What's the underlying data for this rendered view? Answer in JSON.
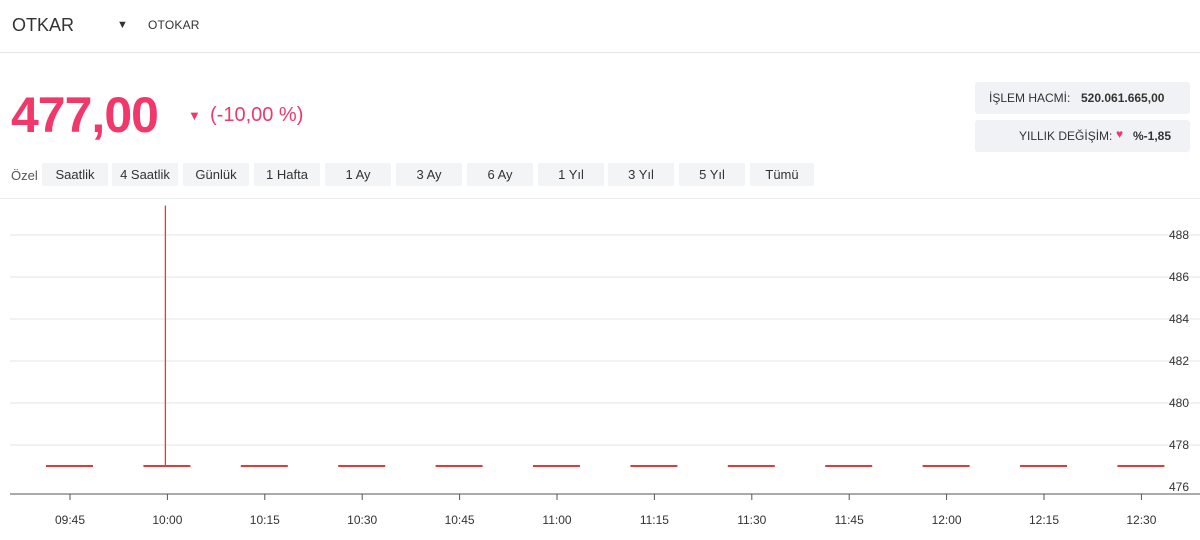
{
  "header": {
    "symbol": "OTKAR",
    "company": "OTOKAR"
  },
  "quote": {
    "price": "477,00",
    "change": "(-10,00 %)"
  },
  "stats": {
    "volume_label": "İŞLEM HACMİ:",
    "volume_value": "520.061.665,00",
    "yearly_label": "YILLIK DEĞİŞİM:",
    "yearly_value": "%-1,85"
  },
  "ranges": {
    "label": "Özel",
    "buttons": [
      "Saatlik",
      "4 Saatlik",
      "Günlük",
      "1 Hafta",
      "1 Ay",
      "3 Ay",
      "6 Ay",
      "1 Yıl",
      "3 Yıl",
      "5 Yıl",
      "Tümü"
    ],
    "active": "4 Saatlik"
  },
  "colors": {
    "accent": "#f0386b",
    "candle": "#e53935",
    "grid": "#e6e6e6"
  },
  "chart_data": {
    "type": "candlestick",
    "x": [
      "09:45",
      "10:00",
      "10:15",
      "10:30",
      "10:45",
      "11:00",
      "11:15",
      "11:30",
      "11:45",
      "12:00",
      "12:15",
      "12:30"
    ],
    "candles": [
      {
        "open": 477,
        "high": 477,
        "low": 477,
        "close": 477
      },
      {
        "open": 477,
        "high": 489.4,
        "low": 477,
        "close": 477
      },
      {
        "open": 477,
        "high": 477,
        "low": 477,
        "close": 477
      },
      {
        "open": 477,
        "high": 477,
        "low": 477,
        "close": 477
      },
      {
        "open": 477,
        "high": 477,
        "low": 477,
        "close": 477
      },
      {
        "open": 477,
        "high": 477,
        "low": 477,
        "close": 477
      },
      {
        "open": 477,
        "high": 477,
        "low": 477,
        "close": 477
      },
      {
        "open": 477,
        "high": 477,
        "low": 477,
        "close": 477
      },
      {
        "open": 477,
        "high": 477,
        "low": 477,
        "close": 477
      },
      {
        "open": 477,
        "high": 477,
        "low": 477,
        "close": 477
      },
      {
        "open": 477,
        "high": 477,
        "low": 477,
        "close": 477
      },
      {
        "open": 477,
        "high": 477,
        "low": 477,
        "close": 477
      }
    ],
    "y_ticks": [
      476,
      478,
      480,
      482,
      484,
      486,
      488
    ],
    "ylim": [
      475.8,
      490
    ],
    "grid": true,
    "y_axis_position": "right"
  }
}
